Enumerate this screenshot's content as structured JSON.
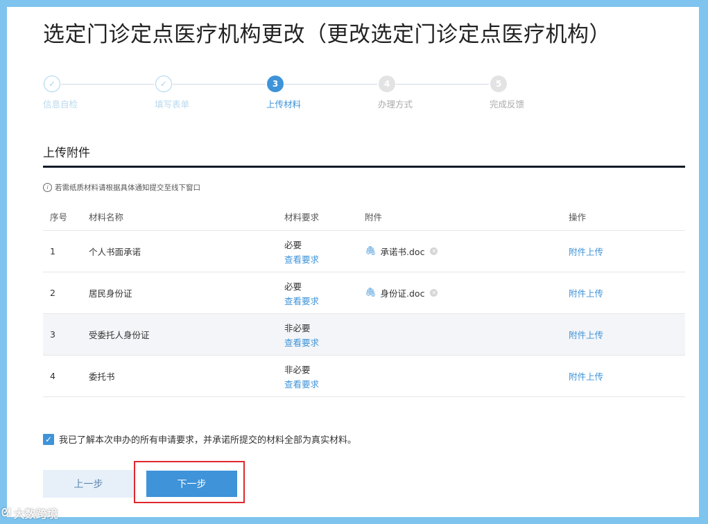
{
  "page": {
    "title": "选定门诊定点医疗机构更改（更改选定门诊定点医疗机构）"
  },
  "steps": [
    {
      "number": "1",
      "label": "信息自检",
      "state": "done"
    },
    {
      "number": "2",
      "label": "填写表单",
      "state": "done"
    },
    {
      "number": "3",
      "label": "上传材料",
      "state": "active"
    },
    {
      "number": "4",
      "label": "办理方式",
      "state": "todo"
    },
    {
      "number": "5",
      "label": "完成反馈",
      "state": "todo"
    }
  ],
  "upload": {
    "section_title": "上传附件",
    "notice": "若需纸质材料请根据具体通知提交至线下窗口"
  },
  "table": {
    "headers": {
      "no": "序号",
      "name": "材料名称",
      "requirement": "材料要求",
      "attachment": "附件",
      "action": "操作"
    },
    "rows": [
      {
        "no": "1",
        "name": "个人书面承诺",
        "requirement": "必要",
        "view_link": "查看要求",
        "attachment": "承诺书.doc",
        "action": "附件上传"
      },
      {
        "no": "2",
        "name": "居民身份证",
        "requirement": "必要",
        "view_link": "查看要求",
        "attachment": "身份证.doc",
        "action": "附件上传"
      },
      {
        "no": "3",
        "name": "受委托人身份证",
        "requirement": "非必要",
        "view_link": "查看要求",
        "attachment": "",
        "action": "附件上传"
      },
      {
        "no": "4",
        "name": "委托书",
        "requirement": "非必要",
        "view_link": "查看要求",
        "attachment": "",
        "action": "附件上传"
      }
    ]
  },
  "agreement": {
    "checked": true,
    "text": "我已了解本次申办的所有申请要求，并承诺所提交的材料全部为真实材料。"
  },
  "buttons": {
    "prev": "上一步",
    "next": "下一步"
  },
  "watermark": {
    "text": "大数跨境"
  },
  "colors": {
    "accent": "#3e93d9",
    "background": "#7ec4ef",
    "highlight": "#e0262c"
  }
}
